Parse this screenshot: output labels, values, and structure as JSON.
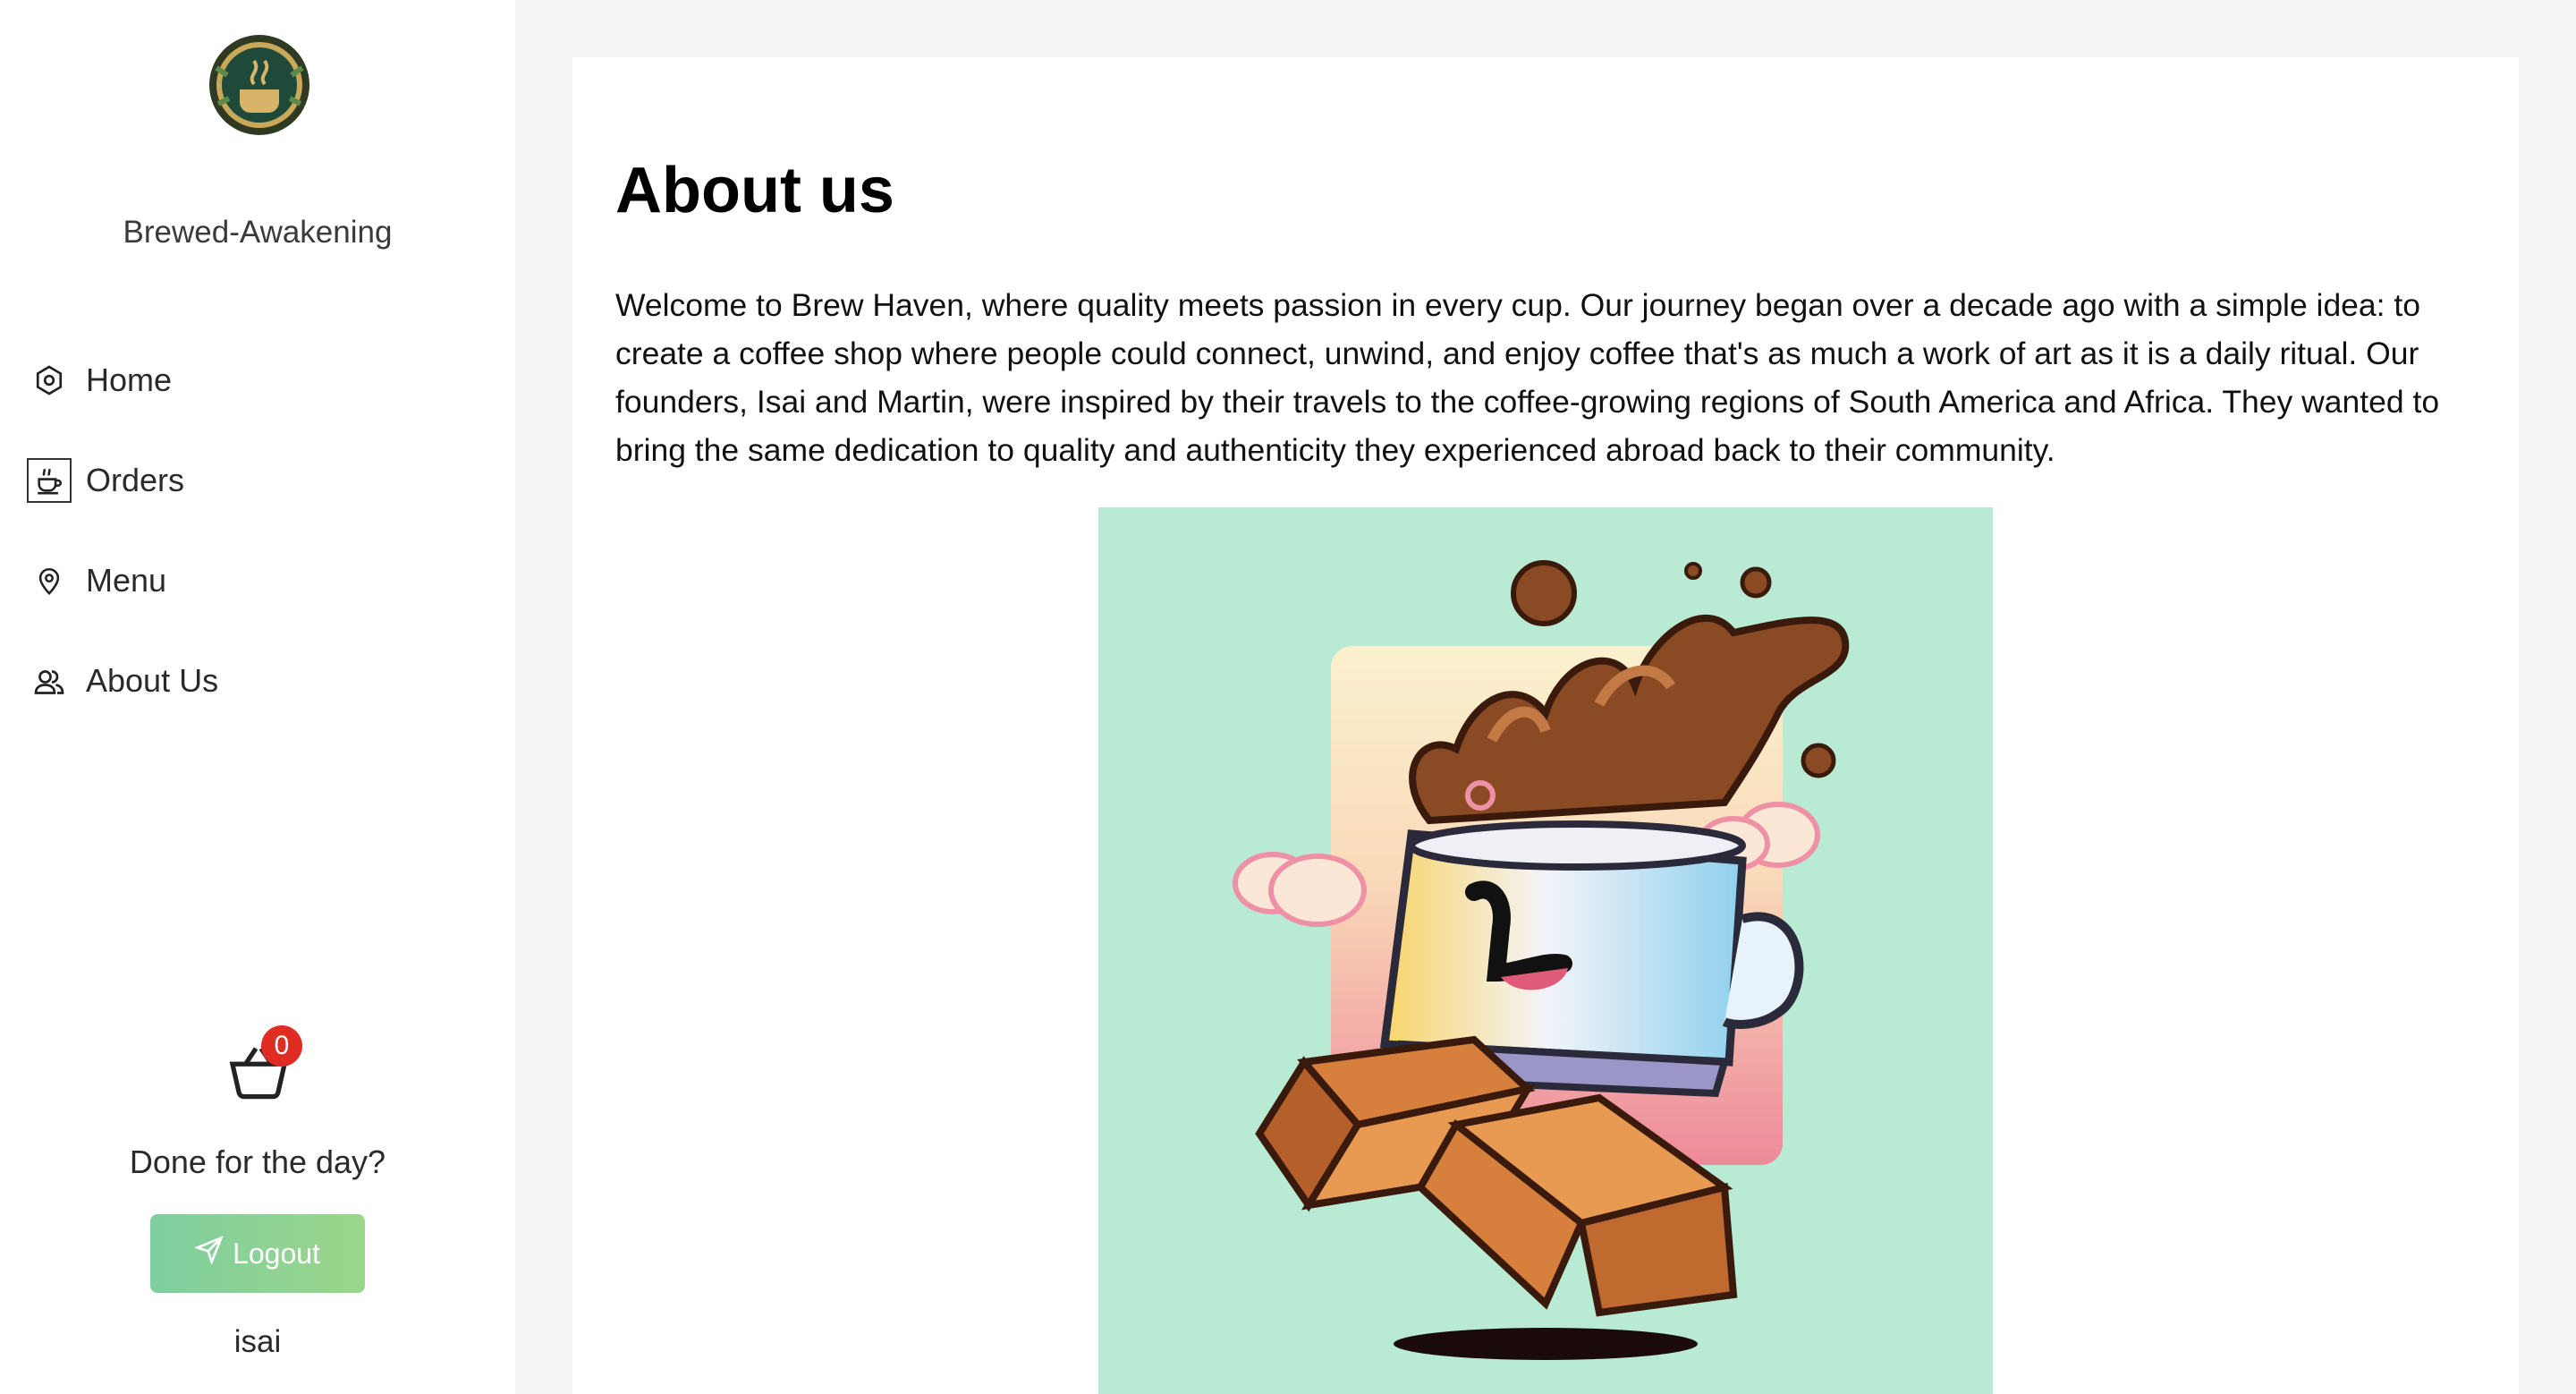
{
  "sidebar": {
    "brand_name": "Brewed-Awakening",
    "logo_icon": "coffee-badge-logo",
    "items": [
      {
        "label": "Home",
        "icon": "hexagon-icon"
      },
      {
        "label": "Orders",
        "icon": "coffee-cup-icon"
      },
      {
        "label": "Menu",
        "icon": "location-pin-icon"
      },
      {
        "label": "About Us",
        "icon": "users-icon"
      }
    ],
    "cart": {
      "count": "0",
      "icon": "basket-icon"
    },
    "done_text": "Done for the day?",
    "logout_label": "Logout",
    "logout_icon": "send-icon",
    "username": "isai"
  },
  "main": {
    "title": "About us",
    "intro": "Welcome to Brew Haven, where quality meets passion in every cup. Our journey began over a decade ago with a simple idea: to create a coffee shop where people could connect, unwind, and enjoy coffee that's as much a work of art as it is a daily ritual. Our founders, Isai and Martin, were inspired by their travels to the coffee-growing regions of South America and Africa. They wanted to bring the same dedication to quality and authenticity they experienced abroad back to their community.",
    "hero_image": "coffee-cup-splash-illustration"
  },
  "colors": {
    "page_bg": "#f5f5f5",
    "sidebar_bg": "#ffffff",
    "badge": "#e02d24",
    "logout_start": "#7fcea0",
    "logout_end": "#9bd68a",
    "hero_bg": "#b8ead4"
  }
}
